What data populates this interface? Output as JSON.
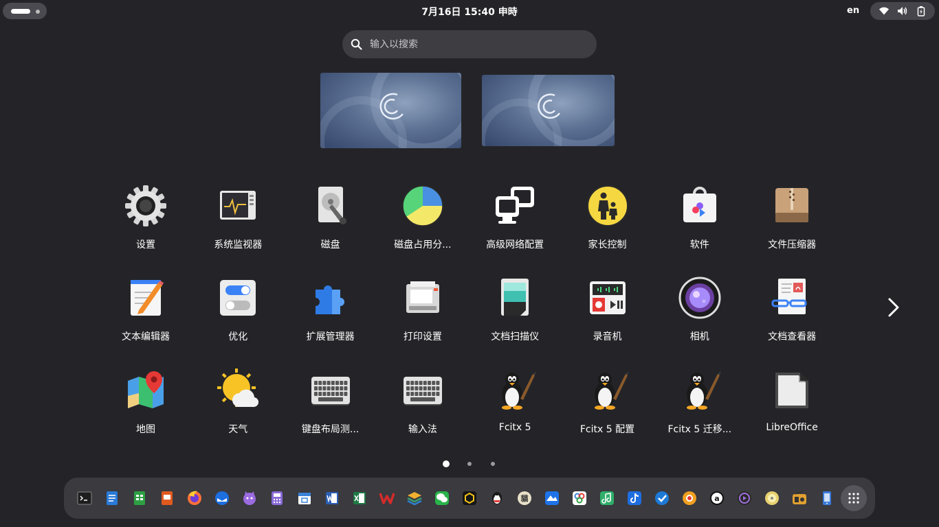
{
  "topbar": {
    "clock": "7月16日  15:40  申時",
    "lang": "en",
    "tray_icons": [
      "wifi-icon",
      "volume-icon",
      "battery-icon"
    ]
  },
  "search": {
    "placeholder": "输入以搜索"
  },
  "apps": [
    {
      "label": "设置",
      "icon": "settings-icon"
    },
    {
      "label": "系统监视器",
      "icon": "system-monitor-icon"
    },
    {
      "label": "磁盘",
      "icon": "disks-icon"
    },
    {
      "label": "磁盘占用分...",
      "icon": "disk-usage-icon"
    },
    {
      "label": "高级网络配置",
      "icon": "network-icon"
    },
    {
      "label": "家长控制",
      "icon": "parental-controls-icon"
    },
    {
      "label": "软件",
      "icon": "software-icon"
    },
    {
      "label": "文件压缩器",
      "icon": "archive-icon"
    },
    {
      "label": "文本编辑器",
      "icon": "text-editor-icon"
    },
    {
      "label": "优化",
      "icon": "tweaks-icon"
    },
    {
      "label": "扩展管理器",
      "icon": "extensions-icon"
    },
    {
      "label": "打印设置",
      "icon": "printer-icon"
    },
    {
      "label": "文档扫描仪",
      "icon": "scanner-icon"
    },
    {
      "label": "录音机",
      "icon": "recorder-icon"
    },
    {
      "label": "相机",
      "icon": "camera-icon"
    },
    {
      "label": "文档查看器",
      "icon": "document-viewer-icon"
    },
    {
      "label": "地图",
      "icon": "maps-icon"
    },
    {
      "label": "天气",
      "icon": "weather-icon"
    },
    {
      "label": "键盘布局测...",
      "icon": "keyboard-icon"
    },
    {
      "label": "输入法",
      "icon": "keyboard-icon"
    },
    {
      "label": "Fcitx 5",
      "icon": "penguin-icon"
    },
    {
      "label": "Fcitx 5 配置",
      "icon": "penguin-icon"
    },
    {
      "label": "Fcitx 5 迁移...",
      "icon": "penguin-icon"
    },
    {
      "label": "LibreOffice",
      "icon": "libreoffice-icon"
    }
  ],
  "pager": {
    "pages": 3,
    "current": 1
  },
  "dock": [
    {
      "name": "terminal-icon",
      "color": "#2b2b30"
    },
    {
      "name": "writer-icon",
      "color": "#1f6fbf"
    },
    {
      "name": "calc-icon",
      "color": "#2e9e42"
    },
    {
      "name": "impress-icon",
      "color": "#e05a1e"
    },
    {
      "name": "firefox-icon",
      "color": "#e86a2a"
    },
    {
      "name": "thunderbird-icon",
      "color": "#2b6fd6"
    },
    {
      "name": "cat-icon",
      "color": "#8a5ad0"
    },
    {
      "name": "calculator-icon",
      "color": "#7a5bd0"
    },
    {
      "name": "calendar-icon",
      "color": "#3b83d8"
    },
    {
      "name": "word-icon",
      "color": "#2b5fb4"
    },
    {
      "name": "excel-icon",
      "color": "#1e7a44"
    },
    {
      "name": "wps-icon",
      "color": "#d52b2b"
    },
    {
      "name": "layers-icon",
      "color": "#3aa070"
    },
    {
      "name": "wechat-icon",
      "color": "#29b34a"
    },
    {
      "name": "cube-icon",
      "color": "#161616"
    },
    {
      "name": "qq-icon",
      "color": "#3a3a3f"
    },
    {
      "name": "cat2-icon",
      "color": "#e8e0c8"
    },
    {
      "name": "feishu-icon",
      "color": "#1e73e8"
    },
    {
      "name": "baidu-icon",
      "color": "#ffffff"
    },
    {
      "name": "music-icon",
      "color": "#2fae6a"
    },
    {
      "name": "tiktok-icon",
      "color": "#1e6ee0"
    },
    {
      "name": "todo-icon",
      "color": "#1e7ad6"
    },
    {
      "name": "star-icon",
      "color": "#f0a020"
    },
    {
      "name": "amazon-icon",
      "color": "#111111"
    },
    {
      "name": "player-icon",
      "color": "#6a3aa8"
    },
    {
      "name": "disc-icon",
      "color": "#e8d070"
    },
    {
      "name": "radio-icon",
      "color": "#e0a030"
    },
    {
      "name": "phone-icon",
      "color": "#3a7ad8"
    }
  ]
}
